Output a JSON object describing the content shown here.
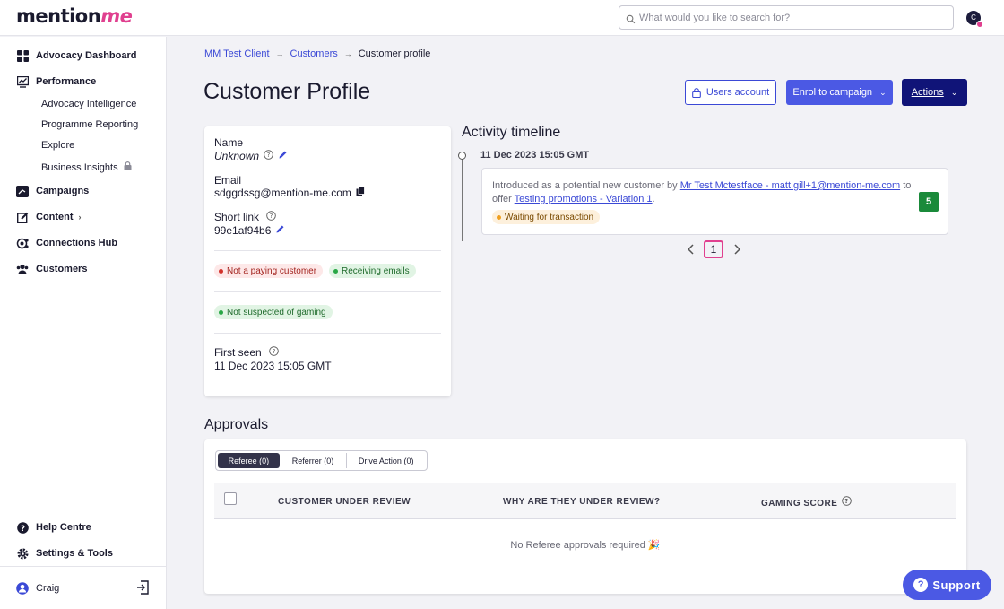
{
  "app": {
    "logo_main": "mention",
    "logo_accent": "me"
  },
  "search": {
    "placeholder": "What would you like to search for?"
  },
  "user": {
    "initial": "C",
    "name": "Craig"
  },
  "sidebar": {
    "advocacy_dashboard": "Advocacy Dashboard",
    "performance": "Performance",
    "performance_items": [
      "Advocacy Intelligence",
      "Programme Reporting",
      "Explore",
      "Business Insights"
    ],
    "campaigns": "Campaigns",
    "content": "Content",
    "connections_hub": "Connections Hub",
    "customers": "Customers",
    "help_centre": "Help Centre",
    "settings_tools": "Settings & Tools"
  },
  "breadcrumb": {
    "client": "MM Test Client",
    "section": "Customers",
    "current": "Customer profile"
  },
  "page_title": "Customer Profile",
  "buttons": {
    "users_account": "Users account",
    "enrol": "Enrol to campaign",
    "actions": "Actions"
  },
  "profile": {
    "name_label": "Name",
    "name_value": "Unknown",
    "email_label": "Email",
    "email_value": "sdggdssg@mention-me.com",
    "short_link_label": "Short link",
    "short_link_value": "99e1af94b6",
    "badges": {
      "not_paying": "Not a paying customer",
      "receiving": "Receiving emails",
      "not_gaming": "Not suspected of gaming"
    },
    "first_seen_label": "First seen",
    "first_seen_value": "11 Dec 2023 15:05 GMT"
  },
  "timeline": {
    "title": "Activity timeline",
    "date": "11 Dec 2023 15:05 GMT",
    "text_before": "Introduced as a potential new customer by ",
    "referrer_link": "Mr Test Mctestface - matt.gill+1@mention-me.com",
    "text_middle": " to offer ",
    "offer_link": "Testing promotions - Variation 1",
    "text_after": ".",
    "status": "Waiting for transaction",
    "score": "5",
    "page": "1"
  },
  "approvals": {
    "title": "Approvals",
    "tabs": [
      "Referee (0)",
      "Referrer (0)",
      "Drive Action (0)"
    ],
    "columns": [
      "CUSTOMER UNDER REVIEW",
      "WHY ARE THEY UNDER REVIEW?",
      "GAMING SCORE"
    ],
    "empty": "No Referee approvals required 🎉"
  },
  "support": {
    "label": "Support"
  },
  "colors": {
    "brand_pink": "#e0408f",
    "primary": "#4b59e4",
    "navy": "#101478",
    "score_green": "#1a8a3a"
  }
}
